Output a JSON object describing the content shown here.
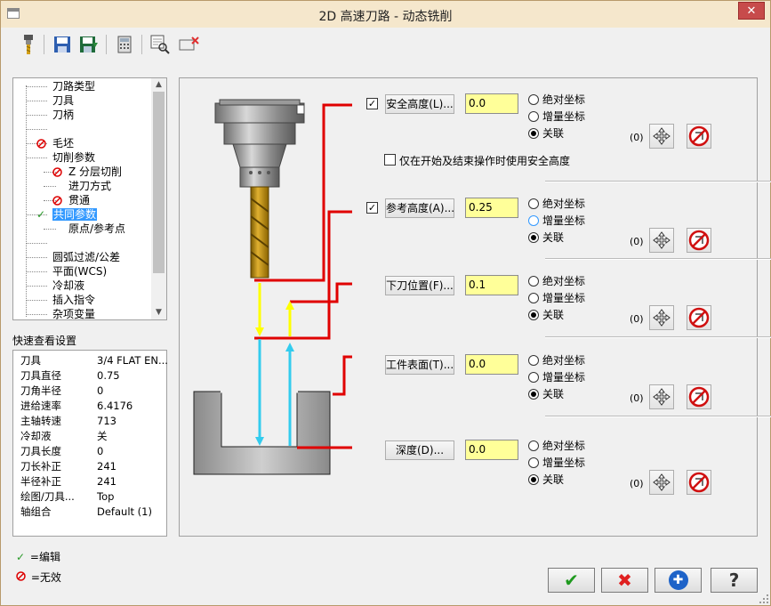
{
  "window": {
    "title": "2D 高速刀路 - 动态铣削",
    "close": "✕"
  },
  "toolbar": {
    "icons": [
      "tool-icon",
      "save-icon",
      "save-as-icon",
      "calculator-icon",
      "view-zoom-icon",
      "delete-icon"
    ]
  },
  "tree": {
    "items": [
      {
        "label": "刀路类型",
        "icon": ""
      },
      {
        "label": "刀具",
        "icon": ""
      },
      {
        "label": "刀柄",
        "icon": ""
      },
      {
        "label": "",
        "icon": ""
      },
      {
        "label": "毛坯",
        "icon": "invalid"
      },
      {
        "label": "切削参数",
        "icon": ""
      },
      {
        "label": "Z 分层切削",
        "icon": "invalid"
      },
      {
        "label": "进刀方式",
        "icon": ""
      },
      {
        "label": "贯通",
        "icon": "invalid"
      },
      {
        "label": "共同参数",
        "icon": "edited",
        "selected": true
      },
      {
        "label": "原点/参考点",
        "icon": ""
      },
      {
        "label": "",
        "icon": ""
      },
      {
        "label": "圆弧过滤/公差",
        "icon": ""
      },
      {
        "label": "平面(WCS)",
        "icon": ""
      },
      {
        "label": "冷却液",
        "icon": ""
      },
      {
        "label": "插入指令",
        "icon": ""
      },
      {
        "label": "杂项变量",
        "icon": ""
      }
    ]
  },
  "quick_view": {
    "label": "快速查看设置",
    "rows": [
      {
        "k": "刀具",
        "v": "3/4 FLAT EN..."
      },
      {
        "k": "刀具直径",
        "v": "0.75"
      },
      {
        "k": "刀角半径",
        "v": "0"
      },
      {
        "k": "进给速率",
        "v": "6.4176"
      },
      {
        "k": "主轴转速",
        "v": "713"
      },
      {
        "k": "冷却液",
        "v": "关"
      },
      {
        "k": "刀具长度",
        "v": "0"
      },
      {
        "k": "刀长补正",
        "v": "241"
      },
      {
        "k": "半径补正",
        "v": "241"
      },
      {
        "k": "绘图/刀具...",
        "v": "Top"
      },
      {
        "k": "轴组合",
        "v": "Default (1)"
      }
    ]
  },
  "legend": {
    "edited": "=编辑",
    "invalid": "=无效"
  },
  "params": [
    {
      "button": "安全高度(L)...",
      "value": "0.0",
      "checked": true,
      "has_check": true,
      "r1": "绝对坐标",
      "r2": "增量坐标",
      "r3": "关联",
      "selected": 3,
      "count": "(0)"
    },
    {
      "button": "参考高度(A)...",
      "value": "0.25",
      "checked": true,
      "has_check": true,
      "r1": "绝对坐标",
      "r2": "增量坐标",
      "r3": "关联",
      "selected": 3,
      "count": "(0)"
    },
    {
      "button": "下刀位置(F)...",
      "value": "0.1",
      "has_check": false,
      "r1": "绝对坐标",
      "r2": "增量坐标",
      "r3": "关联",
      "selected": 3,
      "count": "(0)"
    },
    {
      "button": "工件表面(T)...",
      "value": "0.0",
      "has_check": false,
      "r1": "绝对坐标",
      "r2": "增量坐标",
      "r3": "关联",
      "selected": 3,
      "count": "(0)"
    },
    {
      "button": "深度(D)...",
      "value": "0.0",
      "has_check": false,
      "r1": "绝对坐标",
      "r2": "增量坐标",
      "r3": "关联",
      "selected": 3,
      "count": "(0)"
    }
  ],
  "safe_only_label": "仅在开始及结束操作时使用安全高度",
  "actions": {
    "ok": "✔",
    "cancel": "✖",
    "add": "✚",
    "help": "?"
  }
}
